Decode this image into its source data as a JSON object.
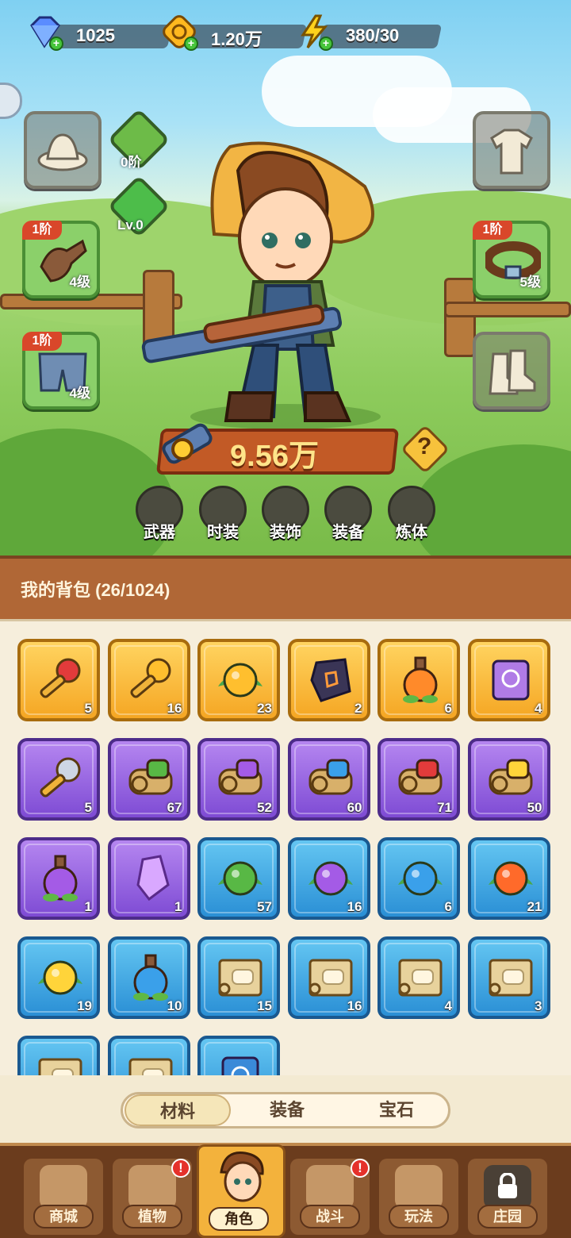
{
  "resources": [
    {
      "icon": "diamond-icon",
      "value": "1025"
    },
    {
      "icon": "gold-coin-icon",
      "value": "1.20万"
    },
    {
      "icon": "energy-icon",
      "value": "380/30"
    }
  ],
  "equipment": {
    "stage_tier": "0阶",
    "gem_level": "Lv.0",
    "gloves": {
      "tier": "1阶",
      "level": "4级"
    },
    "pants": {
      "tier": "1阶",
      "level": "4级"
    },
    "belt": {
      "tier": "1阶",
      "level": "5级"
    }
  },
  "power": "9.56万",
  "help_symbol": "?",
  "categories": [
    "武器",
    "时装",
    "装饰",
    "装备",
    "炼体"
  ],
  "bag": {
    "title": "我的背包 (26/1024)",
    "items": [
      {
        "icon": "red-gem-key-icon",
        "count": "5",
        "rarity": "gold"
      },
      {
        "icon": "gold-key-icon",
        "count": "16",
        "rarity": "gold"
      },
      {
        "icon": "golden-flower-bud-icon",
        "count": "23",
        "rarity": "gold"
      },
      {
        "icon": "rune-stone-icon",
        "count": "2",
        "rarity": "gold"
      },
      {
        "icon": "orange-potion-icon",
        "count": "6",
        "rarity": "gold"
      },
      {
        "icon": "purple-spellbook-icon",
        "count": "4",
        "rarity": "gold"
      },
      {
        "icon": "silver-key-icon",
        "count": "5",
        "rarity": "purple"
      },
      {
        "icon": "green-scroll-icon",
        "count": "67",
        "rarity": "purple"
      },
      {
        "icon": "purple-scroll-icon",
        "count": "52",
        "rarity": "purple"
      },
      {
        "icon": "blue-scroll-icon",
        "count": "60",
        "rarity": "purple"
      },
      {
        "icon": "red-scroll-icon",
        "count": "71",
        "rarity": "purple"
      },
      {
        "icon": "yellow-scroll-icon",
        "count": "50",
        "rarity": "purple"
      },
      {
        "icon": "purple-potion-icon",
        "count": "1",
        "rarity": "purple"
      },
      {
        "icon": "crystal-shard-icon",
        "count": "1",
        "rarity": "purple"
      },
      {
        "icon": "green-seed-orb-icon",
        "count": "57",
        "rarity": "blue"
      },
      {
        "icon": "purple-seed-orb-icon",
        "count": "16",
        "rarity": "blue"
      },
      {
        "icon": "blue-seed-orb-icon",
        "count": "6",
        "rarity": "blue"
      },
      {
        "icon": "fire-seed-orb-icon",
        "count": "21",
        "rarity": "blue"
      },
      {
        "icon": "yellow-seed-orb-icon",
        "count": "19",
        "rarity": "blue"
      },
      {
        "icon": "blue-potion-icon",
        "count": "10",
        "rarity": "blue"
      },
      {
        "icon": "hat-blueprint-icon",
        "count": "15",
        "rarity": "blue"
      },
      {
        "icon": "shirt-blueprint-icon",
        "count": "16",
        "rarity": "blue"
      },
      {
        "icon": "pants-blueprint-icon",
        "count": "4",
        "rarity": "blue"
      },
      {
        "icon": "belt-blueprint-icon",
        "count": "3",
        "rarity": "blue"
      },
      {
        "icon": "blueprint-icon",
        "count": "",
        "rarity": "blue"
      },
      {
        "icon": "blueprint-icon",
        "count": "",
        "rarity": "blue"
      },
      {
        "icon": "blue-book-icon",
        "count": "",
        "rarity": "blue"
      }
    ]
  },
  "tabs": [
    "材料",
    "装备",
    "宝石"
  ],
  "nav": [
    {
      "label": "商城",
      "icon": "shop-icon",
      "badge": ""
    },
    {
      "label": "植物",
      "icon": "plant-icon",
      "badge": "!"
    },
    {
      "label": "角色",
      "icon": "character-icon",
      "badge": ""
    },
    {
      "label": "战斗",
      "icon": "battle-icon",
      "badge": "!"
    },
    {
      "label": "玩法",
      "icon": "gameplay-icon",
      "badge": ""
    },
    {
      "label": "庄园",
      "icon": "manor-lock-icon",
      "badge": ""
    }
  ]
}
